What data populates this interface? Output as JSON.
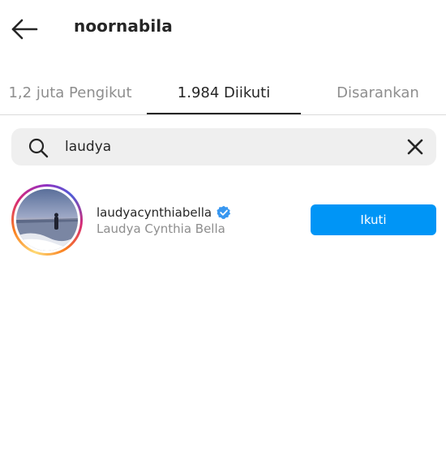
{
  "header": {
    "title": "noornabila",
    "back_icon": "arrow-left-icon"
  },
  "tabs": [
    {
      "label": "1,2 juta Pengikut",
      "active": false
    },
    {
      "label": "1.984 Diikuti",
      "active": true
    },
    {
      "label": "Disarankan",
      "active": false
    }
  ],
  "search": {
    "value": "laudya",
    "search_icon": "search-icon",
    "clear_icon": "close-icon"
  },
  "results": [
    {
      "username": "laudyacynthiabella",
      "verified": true,
      "full_name": "Laudya Cynthia Bella",
      "follow_label": "Ikuti"
    }
  ],
  "colors": {
    "accent": "#0095f6",
    "verified_badge": "#3897f0",
    "text_primary": "#262626",
    "text_secondary": "#8e8e8e",
    "search_bg": "#efefef"
  }
}
